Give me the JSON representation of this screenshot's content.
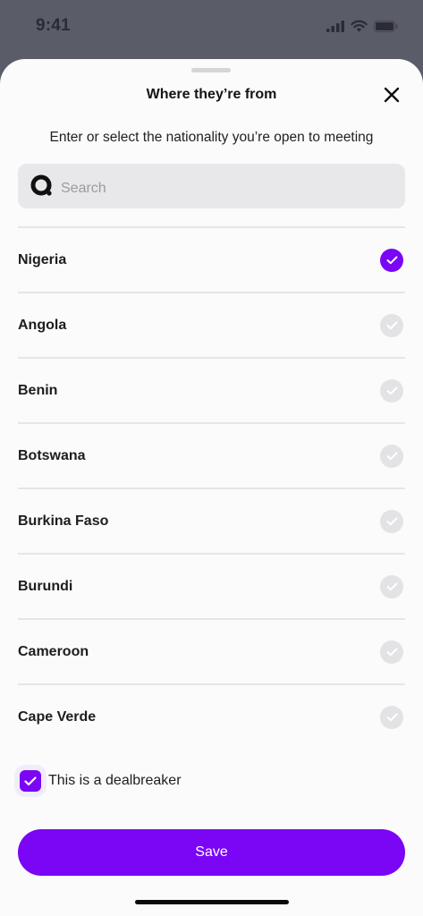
{
  "status_bar": {
    "time": "9:41"
  },
  "sheet": {
    "title": "Where they’re from",
    "subtitle": "Enter or select the nationality you’re open to meeting"
  },
  "search": {
    "placeholder": "Search",
    "value": ""
  },
  "countries": [
    {
      "name": "Nigeria",
      "selected": true
    },
    {
      "name": "Angola",
      "selected": false
    },
    {
      "name": "Benin",
      "selected": false
    },
    {
      "name": "Botswana",
      "selected": false
    },
    {
      "name": "Burkina Faso",
      "selected": false
    },
    {
      "name": "Burundi",
      "selected": false
    },
    {
      "name": "Cameroon",
      "selected": false
    },
    {
      "name": "Cape Verde",
      "selected": false
    }
  ],
  "dealbreaker": {
    "label": "This is a dealbreaker",
    "checked": true
  },
  "save_label": "Save",
  "colors": {
    "accent": "#7a06f5",
    "unchecked": "#e3e3e5",
    "backdrop": "#5a5c67"
  }
}
